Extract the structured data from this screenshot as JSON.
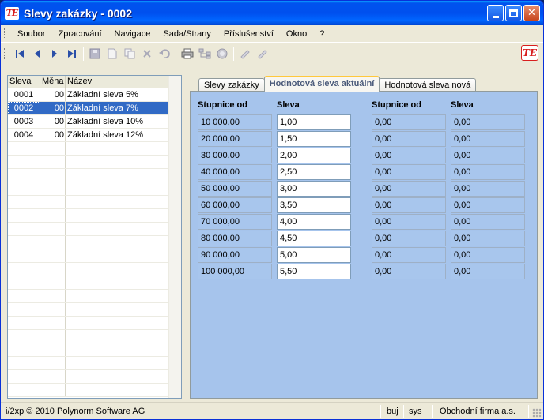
{
  "window": {
    "logo_text": "TE",
    "title": "Slevy zakázky - 0002"
  },
  "menu": [
    "Soubor",
    "Zpracování",
    "Navigace",
    "Sada/Strany",
    "Příslušenství",
    "Okno",
    "?"
  ],
  "toolbar": {
    "icons": [
      "first-record-icon",
      "prev-record-icon",
      "next-record-icon",
      "last-record-icon",
      "save-icon",
      "new-icon",
      "copy-icon",
      "delete-icon",
      "undo-icon",
      "print-icon",
      "tree-icon",
      "stop-icon",
      "edit-icon",
      "edit-alt-icon"
    ],
    "brand_text": "TE"
  },
  "list": {
    "headers": [
      "Sleva",
      "Měna",
      "Název"
    ],
    "rows": [
      {
        "sleva": "0001",
        "mena": "00",
        "nazev": "Základní sleva 5%"
      },
      {
        "sleva": "0002",
        "mena": "00",
        "nazev": "Základní sleva 7%"
      },
      {
        "sleva": "0003",
        "mena": "00",
        "nazev": "Základní sleva 10%"
      },
      {
        "sleva": "0004",
        "mena": "00",
        "nazev": "Základní sleva 12%"
      }
    ],
    "selected_row": "0002"
  },
  "tabs": [
    "Slevy zakázky",
    "Hodnotová sleva aktuální",
    "Hodnotová sleva nová"
  ],
  "active_tab": "Hodnotová sleva aktuální",
  "table": {
    "headers": [
      "Stupnice od",
      "Sleva",
      "Stupnice od",
      "Sleva"
    ],
    "current_from": [
      "10 000,00",
      "20 000,00",
      "30 000,00",
      "40 000,00",
      "50 000,00",
      "60 000,00",
      "70 000,00",
      "80 000,00",
      "90 000,00",
      "100 000,00"
    ],
    "current_discount": [
      "1,00",
      "1,50",
      "2,00",
      "2,50",
      "3,00",
      "3,50",
      "4,00",
      "4,50",
      "5,00",
      "5,50"
    ],
    "new_from": [
      "0,00",
      "0,00",
      "0,00",
      "0,00",
      "0,00",
      "0,00",
      "0,00",
      "0,00",
      "0,00",
      "0,00"
    ],
    "new_discount": [
      "0,00",
      "0,00",
      "0,00",
      "0,00",
      "0,00",
      "0,00",
      "0,00",
      "0,00",
      "0,00",
      "0,00"
    ]
  },
  "status": {
    "copyright": "i/2xp © 2010 Polynorm Software AG",
    "user1": "buj",
    "user2": "sys",
    "company": "Obchodní firma a.s."
  }
}
